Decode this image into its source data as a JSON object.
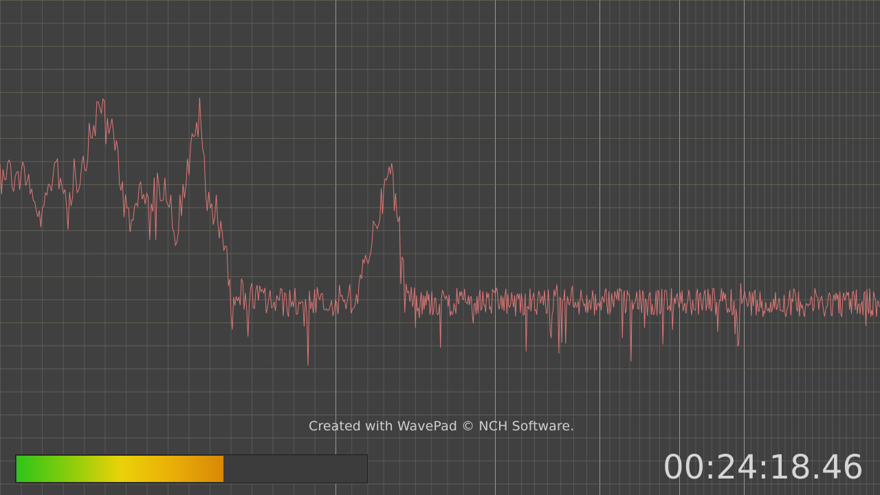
{
  "app": {
    "watermark_text": "Created with WavePad © NCH Software.",
    "timecode": "00:24:18.46"
  },
  "level_meter": {
    "level_fraction": 0.59
  },
  "colors": {
    "background": "#404040",
    "grid_minor": "#5a5a5a",
    "grid_horizontal": "#7a7a62",
    "grid_major": "#a9a9a9",
    "spectrum_line": "#e07878"
  },
  "spectrum": {
    "scale": "log-frequency",
    "description_hidden": true
  }
}
